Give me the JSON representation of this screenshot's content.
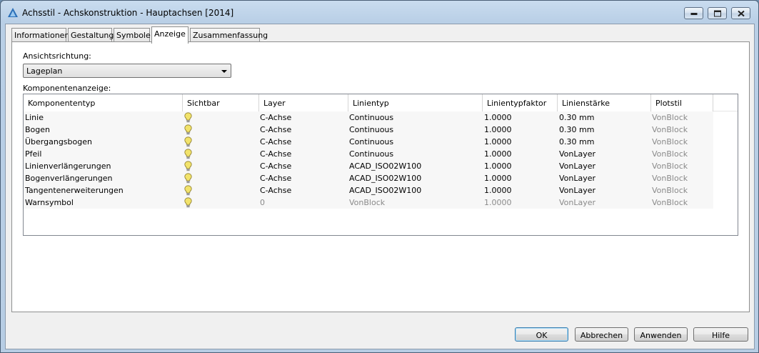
{
  "window": {
    "title": "Achsstil - Achskonstruktion - Hauptachsen [2014]"
  },
  "tabs": [
    {
      "label": "Informationen",
      "active": false
    },
    {
      "label": "Gestaltung",
      "active": false
    },
    {
      "label": "Symbole",
      "active": false
    },
    {
      "label": "Anzeige",
      "active": true
    },
    {
      "label": "Zusammenfassung",
      "active": false
    }
  ],
  "view_direction": {
    "label": "Ansichtsrichtung:",
    "value": "Lageplan"
  },
  "component_display": {
    "label": "Komponentenanzeige:",
    "columns": [
      "Komponententyp",
      "Sichtbar",
      "Layer",
      "Linientyp",
      "Linientypfaktor",
      "Linienstärke",
      "Plotstil"
    ],
    "rows": [
      {
        "type": "Linie",
        "visible": true,
        "layer": "C-Achse",
        "linetype": "Continuous",
        "factor": "1.0000",
        "weight": "0.30 mm",
        "plotstyle": "VonBlock",
        "dim": false
      },
      {
        "type": "Bogen",
        "visible": true,
        "layer": "C-Achse",
        "linetype": "Continuous",
        "factor": "1.0000",
        "weight": "0.30 mm",
        "plotstyle": "VonBlock",
        "dim": false
      },
      {
        "type": "Übergangsbogen",
        "visible": true,
        "layer": "C-Achse",
        "linetype": "Continuous",
        "factor": "1.0000",
        "weight": "0.30 mm",
        "plotstyle": "VonBlock",
        "dim": false
      },
      {
        "type": "Pfeil",
        "visible": true,
        "layer": "C-Achse",
        "linetype": "Continuous",
        "factor": "1.0000",
        "weight": "VonLayer",
        "plotstyle": "VonBlock",
        "dim": false
      },
      {
        "type": "Linienverlängerungen",
        "visible": true,
        "layer": "C-Achse",
        "linetype": "ACAD_ISO02W100",
        "factor": "1.0000",
        "weight": "VonLayer",
        "plotstyle": "VonBlock",
        "dim": false
      },
      {
        "type": "Bogenverlängerungen",
        "visible": true,
        "layer": "C-Achse",
        "linetype": "ACAD_ISO02W100",
        "factor": "1.0000",
        "weight": "VonLayer",
        "plotstyle": "VonBlock",
        "dim": false
      },
      {
        "type": "Tangentenerweiterungen",
        "visible": true,
        "layer": "C-Achse",
        "linetype": "ACAD_ISO02W100",
        "factor": "1.0000",
        "weight": "VonLayer",
        "plotstyle": "VonBlock",
        "dim": false
      },
      {
        "type": "Warnsymbol",
        "visible": true,
        "layer": "0",
        "linetype": "VonBlock",
        "factor": "1.0000",
        "weight": "VonLayer",
        "plotstyle": "VonBlock",
        "dim": true
      }
    ]
  },
  "buttons": {
    "ok": "OK",
    "cancel": "Abbrechen",
    "apply": "Anwenden",
    "help": "Hilfe"
  },
  "icons": {
    "app": "autocad-civil-triangle-icon",
    "visible": "lightbulb-on-icon"
  },
  "colors": {
    "accent": "#3c7fb1",
    "bulb": "#f2e36b",
    "dim_text": "#8a8a8a"
  }
}
